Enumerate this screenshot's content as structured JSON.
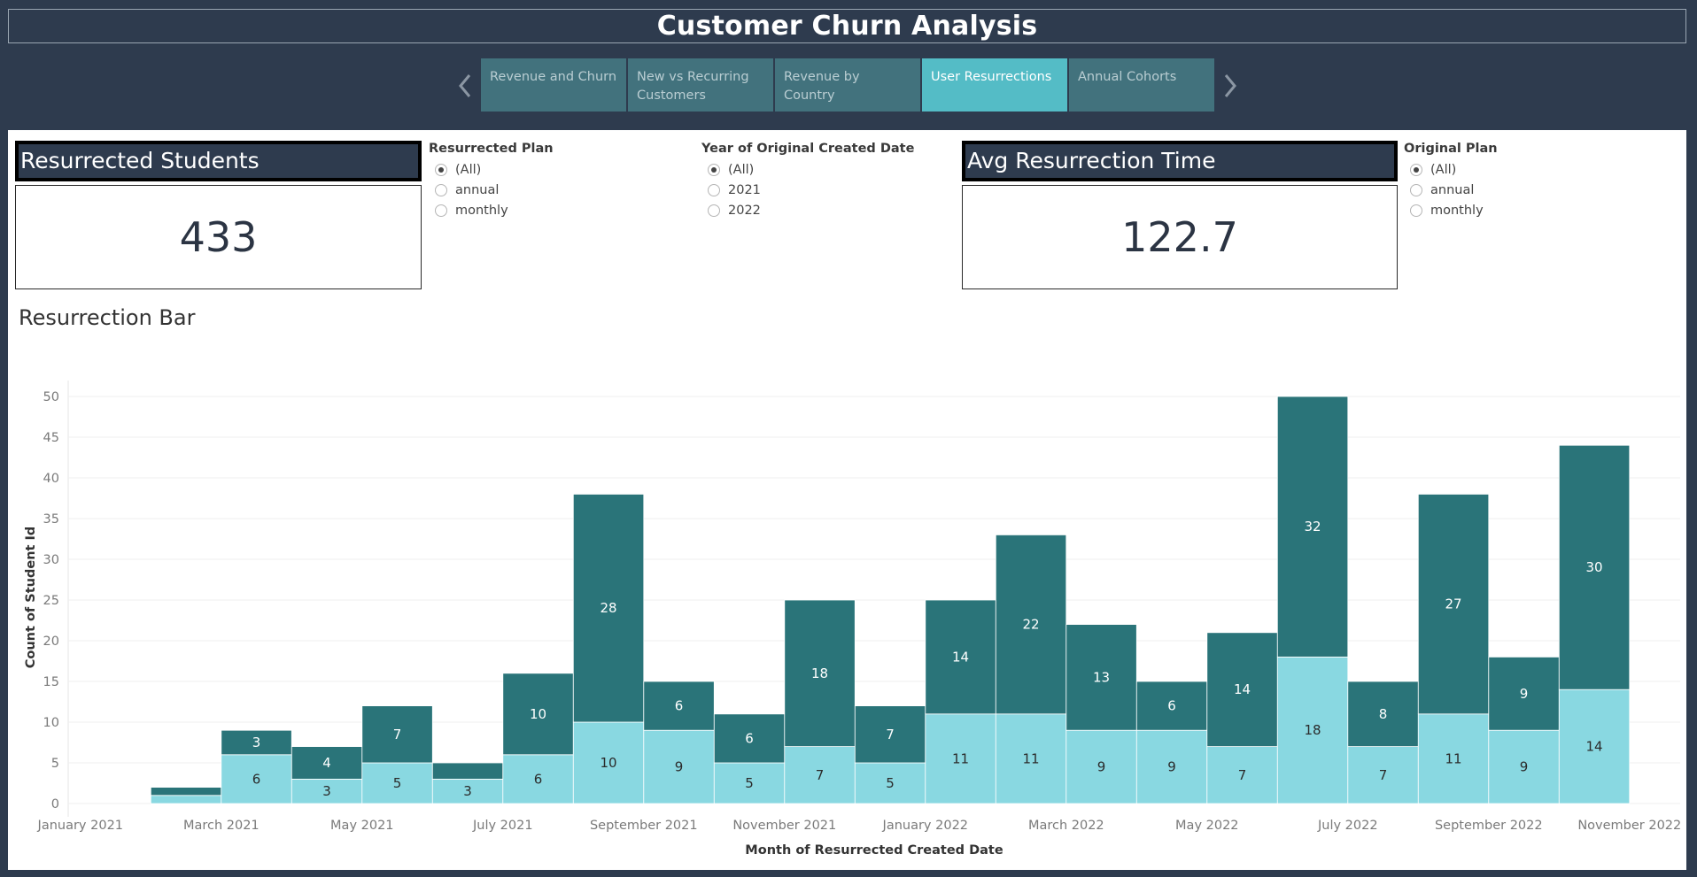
{
  "header": {
    "title": "Customer Churn Analysis"
  },
  "tabs": [
    {
      "label": "Revenue and Churn",
      "active": false
    },
    {
      "label": "New vs Recurring Customers",
      "active": false
    },
    {
      "label": "Revenue by Country",
      "active": false
    },
    {
      "label": "User Resurrections",
      "active": true
    },
    {
      "label": "Annual Cohorts",
      "active": false
    }
  ],
  "nav": {
    "prev_icon": "chevron-left-icon",
    "next_icon": "chevron-right-icon"
  },
  "kpis": {
    "resurrected_students": {
      "title": "Resurrected Students",
      "value": "433"
    },
    "avg_resurrection_time": {
      "title": "Avg Resurrection Time",
      "value": "122.7"
    }
  },
  "filters": {
    "resurrected_plan": {
      "title": "Resurrected Plan",
      "options": [
        "(All)",
        "annual",
        "monthly"
      ],
      "selected": "(All)"
    },
    "year_original_created": {
      "title": "Year of Original Created Date",
      "options": [
        "(All)",
        "2021",
        "2022"
      ],
      "selected": "(All)"
    },
    "original_plan": {
      "title": "Original Plan",
      "options": [
        "(All)",
        "annual",
        "monthly"
      ],
      "selected": "(All)"
    }
  },
  "colors": {
    "dark_series": "#2a7479",
    "light_series": "#89d8e1",
    "header_bg": "#2e3b4e",
    "active_tab": "#54bcc6",
    "tab": "#42727d"
  },
  "chart_data": {
    "type": "bar",
    "stacked": true,
    "title": "Resurrection Bar",
    "xlabel": "Month of Resurrected Created Date",
    "ylabel": "Count of Student Id",
    "ylim": [
      0,
      50
    ],
    "yticks": [
      0,
      5,
      10,
      15,
      20,
      25,
      30,
      35,
      40,
      45,
      50
    ],
    "grid": true,
    "x_tick_labels": [
      "January 2021",
      "March 2021",
      "May 2021",
      "July 2021",
      "September 2021",
      "November 2021",
      "January 2022",
      "March 2022",
      "May 2022",
      "July 2022",
      "September 2022",
      "November 2022"
    ],
    "categories": [
      "2021-01",
      "2021-02",
      "2021-03",
      "2021-04",
      "2021-05",
      "2021-06",
      "2021-07",
      "2021-08",
      "2021-09",
      "2021-10",
      "2021-11",
      "2021-12",
      "2022-01",
      "2022-02",
      "2022-03",
      "2022-04",
      "2022-05",
      "2022-06",
      "2022-07",
      "2022-08",
      "2022-09",
      "2022-10",
      "2022-11"
    ],
    "series": [
      {
        "values": [
          0,
          1,
          6,
          3,
          5,
          3,
          6,
          10,
          9,
          5,
          7,
          5,
          11,
          11,
          9,
          9,
          7,
          18,
          7,
          11,
          9,
          14,
          0
        ]
      },
      {
        "values": [
          0,
          1,
          3,
          4,
          7,
          2,
          10,
          28,
          6,
          6,
          18,
          7,
          14,
          22,
          13,
          6,
          14,
          32,
          8,
          27,
          9,
          30,
          0
        ]
      }
    ]
  }
}
